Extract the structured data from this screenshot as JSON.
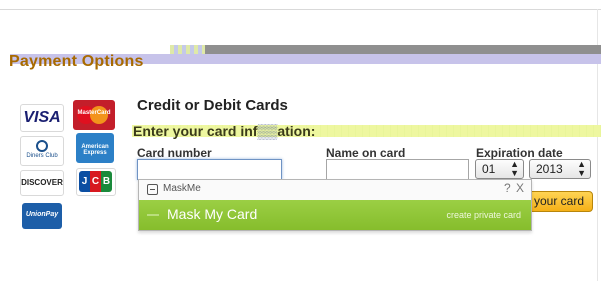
{
  "header": {
    "title": "Payment Options"
  },
  "card_logos": [
    {
      "name": "VISA"
    },
    {
      "name": "MasterCard"
    },
    {
      "name": "Diners Club"
    },
    {
      "name": "American Express"
    },
    {
      "name": "DISCOVER"
    },
    {
      "name": "JCB"
    },
    {
      "name": "UnionPay"
    }
  ],
  "form": {
    "section_title": "Credit or Debit Cards",
    "instruction_start": "Enter your card inf",
    "instruction_end": "ation:",
    "card_number_label": "Card number",
    "card_number_value": "",
    "name_label": "Name on card",
    "name_value": "",
    "expiration_label": "Expiration date",
    "month_value": "01",
    "year_value": "2013",
    "submit_visible_text": "your card"
  },
  "maskme": {
    "brand": "MaskMe",
    "help_icon": "?",
    "close_icon": "X",
    "option_label": "Mask My Card",
    "option_action": "create private card",
    "accent_color": "#8dc63f"
  }
}
